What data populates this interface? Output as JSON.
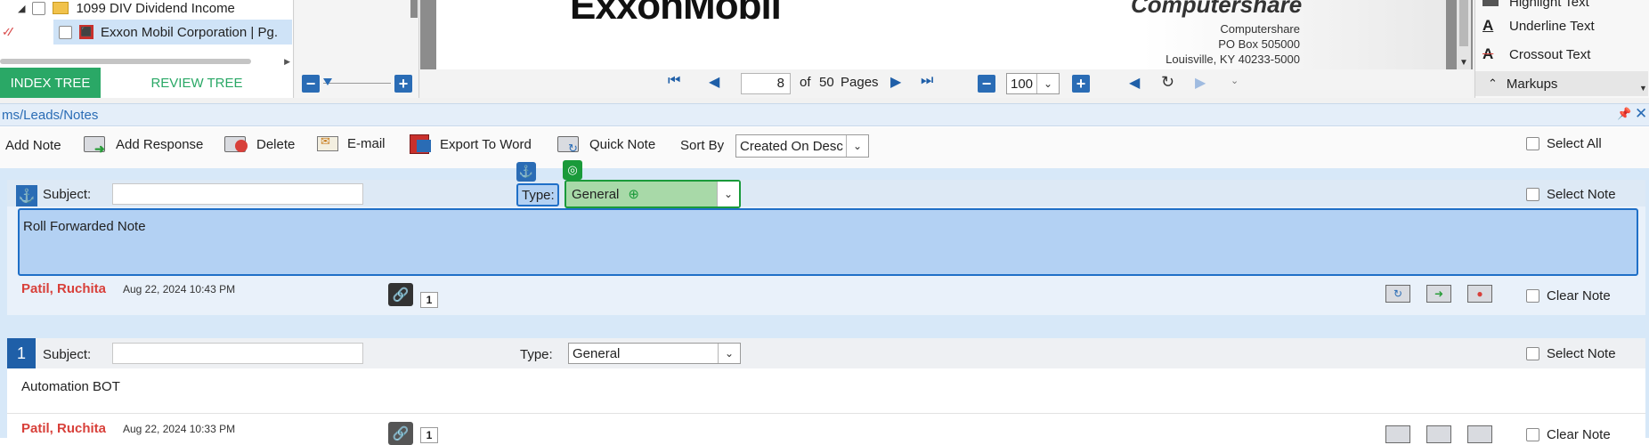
{
  "tree": {
    "items": [
      {
        "label": "1099 DIV Dividend Income"
      },
      {
        "label": "Exxon Mobil Corporation  | Pg."
      }
    ],
    "tabs": {
      "index": "INDEX TREE",
      "review": "REVIEW TREE"
    }
  },
  "document": {
    "brand": "ExxonMobil",
    "brand_right": "Computershare",
    "address": [
      "Computershare",
      "PO Box 505000",
      "Louisville, KY 40233-5000"
    ]
  },
  "pager": {
    "page": "8",
    "of_label": "of",
    "total": "50",
    "pages_label": "Pages",
    "zoom": "100"
  },
  "markups": {
    "items": [
      {
        "label": "Highlight Text"
      },
      {
        "label": "Underline Text"
      },
      {
        "label": "Crossout Text"
      }
    ],
    "section_label": "Markups"
  },
  "panel": {
    "title": "ms/Leads/Notes"
  },
  "toolbar": {
    "add_note": "Add Note",
    "add_response": "Add Response",
    "delete": "Delete",
    "email": "E-mail",
    "export_word": "Export To Word",
    "quick_note": "Quick Note",
    "sort_by": "Sort By",
    "sort_value": "Created On Desc",
    "select_all": "Select All"
  },
  "notes": [
    {
      "subject_label": "Subject:",
      "type_label": "Type:",
      "type_value": "General",
      "select_label": "Select Note",
      "body": "Roll Forwarded Note",
      "author": "Patil, Ruchita",
      "date": "Aug 22, 2024 10:43 PM",
      "link_count": "1",
      "clear_label": "Clear Note"
    },
    {
      "number": "1",
      "subject_label": "Subject:",
      "type_label": "Type:",
      "type_value": "General",
      "select_label": "Select Note",
      "body": "Automation BOT",
      "author": "Patil, Ruchita",
      "date": "Aug 22, 2024 10:33 PM",
      "link_count": "1",
      "clear_label": "Clear Note"
    }
  ],
  "colors": {
    "accent": "#1f6fc7",
    "tab_green": "#2aa866",
    "author_red": "#d8403a",
    "highlight_blue": "#b3d1f3",
    "highlight_green": "#a8d9a8"
  }
}
